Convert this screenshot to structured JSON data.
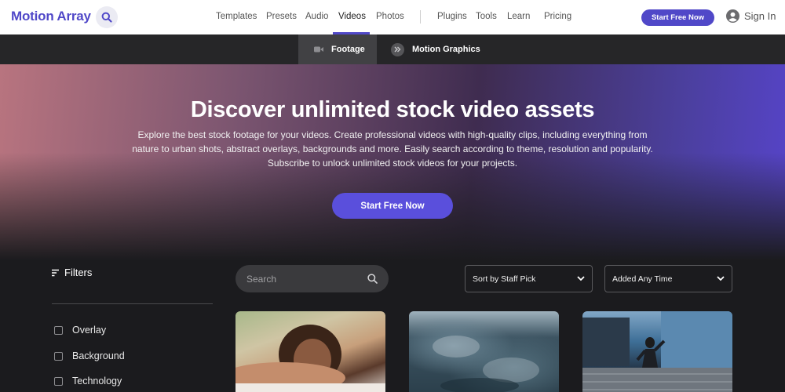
{
  "brand": {
    "logo_text": "Motion Array",
    "accent": "#5048c8"
  },
  "topnav": {
    "links": [
      "Templates",
      "Presets",
      "Audio",
      "Videos",
      "Photos",
      "Plugins",
      "Tools",
      "Learn",
      "Pricing"
    ],
    "active": "Videos",
    "cta_label": "Start Free Now",
    "signin_label": "Sign In",
    "icons": {
      "search": "search-icon",
      "user": "user-icon"
    }
  },
  "subnav": {
    "tabs": [
      {
        "label": "Footage",
        "icon": "video-camera-icon",
        "active": true
      },
      {
        "label": "Motion Graphics",
        "icon": "double-chevron-icon",
        "active": false
      }
    ]
  },
  "hero": {
    "title": "Discover unlimited stock video assets",
    "description": "Explore the best stock footage for your videos. Create professional videos with high-quality clips, including everything from nature to urban shots, abstract overlays, backgrounds and more. Easily search according to theme, resolution and popularity. Subscribe to unlock unlimited stock videos for your projects.",
    "cta_label": "Start Free Now"
  },
  "filters": {
    "heading": "Filters",
    "items": [
      "Overlay",
      "Background",
      "Technology"
    ]
  },
  "search": {
    "placeholder": "Search"
  },
  "sort": {
    "selected": "Sort by Staff Pick"
  },
  "time_filter": {
    "selected": "Added Any Time"
  },
  "cards": [
    {
      "subject": "woman-lying-down-thumbnail"
    },
    {
      "subject": "earth-from-space-thumbnail"
    },
    {
      "subject": "businessman-jumping-thumbnail"
    }
  ]
}
